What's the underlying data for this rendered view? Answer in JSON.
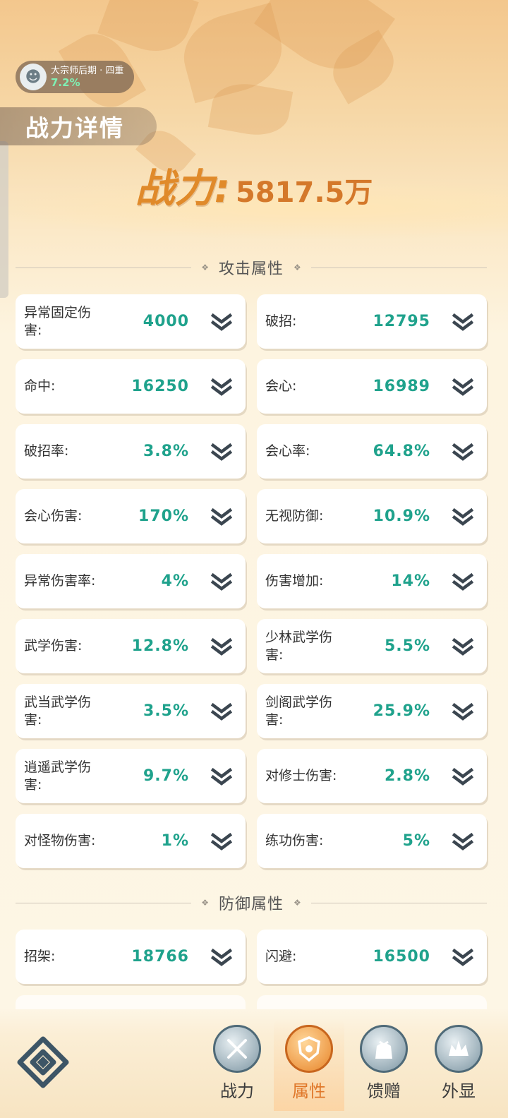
{
  "realm": {
    "name": "大宗师后期 · 四重",
    "progress": "7.2%"
  },
  "page_title": "战力详情",
  "power": {
    "label": "战力:",
    "value": "5817.5万"
  },
  "sections": {
    "attack": {
      "title": "攻击属性",
      "stats": [
        {
          "label": "异常固定伤害:",
          "value": "4000"
        },
        {
          "label": "破招:",
          "value": "12795"
        },
        {
          "label": "命中:",
          "value": "16250"
        },
        {
          "label": "会心:",
          "value": "16989"
        },
        {
          "label": "破招率:",
          "value": "3.8%"
        },
        {
          "label": "会心率:",
          "value": "64.8%"
        },
        {
          "label": "会心伤害:",
          "value": "170%"
        },
        {
          "label": "无视防御:",
          "value": "10.9%"
        },
        {
          "label": "异常伤害率:",
          "value": "4%"
        },
        {
          "label": "伤害增加:",
          "value": "14%"
        },
        {
          "label": "武学伤害:",
          "value": "12.8%"
        },
        {
          "label": "少林武学伤害:",
          "value": "5.5%"
        },
        {
          "label": "武当武学伤害:",
          "value": "3.5%"
        },
        {
          "label": "剑阁武学伤害:",
          "value": "25.9%"
        },
        {
          "label": "逍遥武学伤害:",
          "value": "9.7%"
        },
        {
          "label": "对修士伤害:",
          "value": "2.8%"
        },
        {
          "label": "对怪物伤害:",
          "value": "1%"
        },
        {
          "label": "练功伤害:",
          "value": "5%"
        }
      ]
    },
    "defense": {
      "title": "防御属性",
      "stats": [
        {
          "label": "招架:",
          "value": "18766"
        },
        {
          "label": "闪避:",
          "value": "16500"
        }
      ]
    }
  },
  "tabs": [
    {
      "label": "战力",
      "icon": "swords-icon",
      "active": false
    },
    {
      "label": "属性",
      "icon": "shield-emblem-icon",
      "active": true
    },
    {
      "label": "馈赠",
      "icon": "gift-bag-icon",
      "active": false
    },
    {
      "label": "外显",
      "icon": "crown-wings-icon",
      "active": false
    }
  ],
  "colors": {
    "accent": "#e0782a",
    "value": "#1fa28c",
    "card": "#ffffff"
  }
}
